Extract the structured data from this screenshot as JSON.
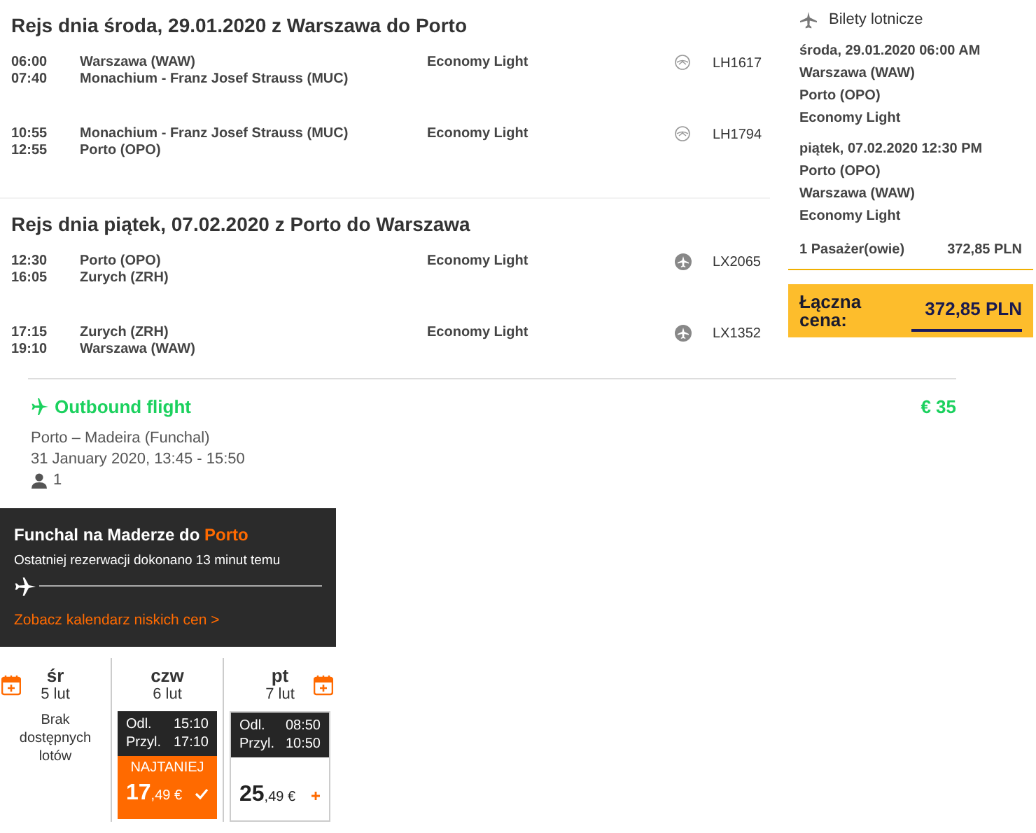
{
  "trips": [
    {
      "title": "Rejs dnia środa, 29.01.2020 z Warszawa do Porto",
      "segments": [
        {
          "dep_time": "06:00",
          "arr_time": "07:40",
          "from": "Warszawa (WAW)",
          "to": "Monachium - Franz Josef Strauss (MUC)",
          "fare": "Economy Light",
          "kind": "crane",
          "flight": "LH1617"
        },
        {
          "dep_time": "10:55",
          "arr_time": "12:55",
          "from": "Monachium - Franz Josef Strauss (MUC)",
          "to": "Porto (OPO)",
          "fare": "Economy Light",
          "kind": "crane",
          "flight": "LH1794"
        }
      ]
    },
    {
      "title": "Rejs dnia piątek, 07.02.2020 z Porto do Warszawa",
      "segments": [
        {
          "dep_time": "12:30",
          "arr_time": "16:05",
          "from": "Porto (OPO)",
          "to": "Zurych (ZRH)",
          "fare": "Economy Light",
          "kind": "plane",
          "flight": "LX2065"
        },
        {
          "dep_time": "17:15",
          "arr_time": "19:10",
          "from": "Zurych (ZRH)",
          "to": "Warszawa (WAW)",
          "fare": "Economy Light",
          "kind": "plane",
          "flight": "LX1352"
        }
      ]
    }
  ],
  "summary": {
    "title": "Bilety lotnicze",
    "legs": [
      {
        "date": "środa, 29.01.2020 06:00 AM",
        "lines": [
          "Warszawa (WAW)",
          "Porto (OPO)",
          "Economy Light"
        ]
      },
      {
        "date": "piątek, 07.02.2020 12:30 PM",
        "lines": [
          "Porto (OPO)",
          "Warszawa (WAW)",
          "Economy Light"
        ]
      }
    ],
    "passengers": "1 Pasażer(owie)",
    "subtotal": "372,85 PLN",
    "total_label": "Łączna cena:",
    "total": "372,85 PLN"
  },
  "outbound": {
    "title": "Outbound flight",
    "price": "€ 35",
    "route": "Porto – Madeira (Funchal)",
    "datetime": "31 January 2020, 13:45 - 15:50",
    "passengers": "1"
  },
  "banner": {
    "title": "Funchal na Maderze do ",
    "destination": "Porto",
    "subtitle": "Ostatniej rezerwacji dokonano 13 minut temu",
    "link": "Zobacz kalendarz niskich cen >"
  },
  "calendar": {
    "days": [
      {
        "kind": "empty",
        "weekday": "śr",
        "date": "5 lut",
        "message": "Brak dostępnych lotów"
      },
      {
        "kind": "fare",
        "weekday": "czw",
        "date": "6 lut",
        "selected": true,
        "dep_label": "Odl.",
        "dep": "15:10",
        "arr_label": "Przyl.",
        "arr": "17:10",
        "badge": "NAJTANIEJ",
        "price_main": "17",
        "price_rest": ",49 €"
      },
      {
        "kind": "fare",
        "weekday": "pt",
        "date": "7 lut",
        "selected": false,
        "dep_label": "Odl.",
        "dep": "08:50",
        "arr_label": "Przyl.",
        "arr": "10:50",
        "price_main": "25",
        "price_rest": ",49 €"
      }
    ]
  }
}
